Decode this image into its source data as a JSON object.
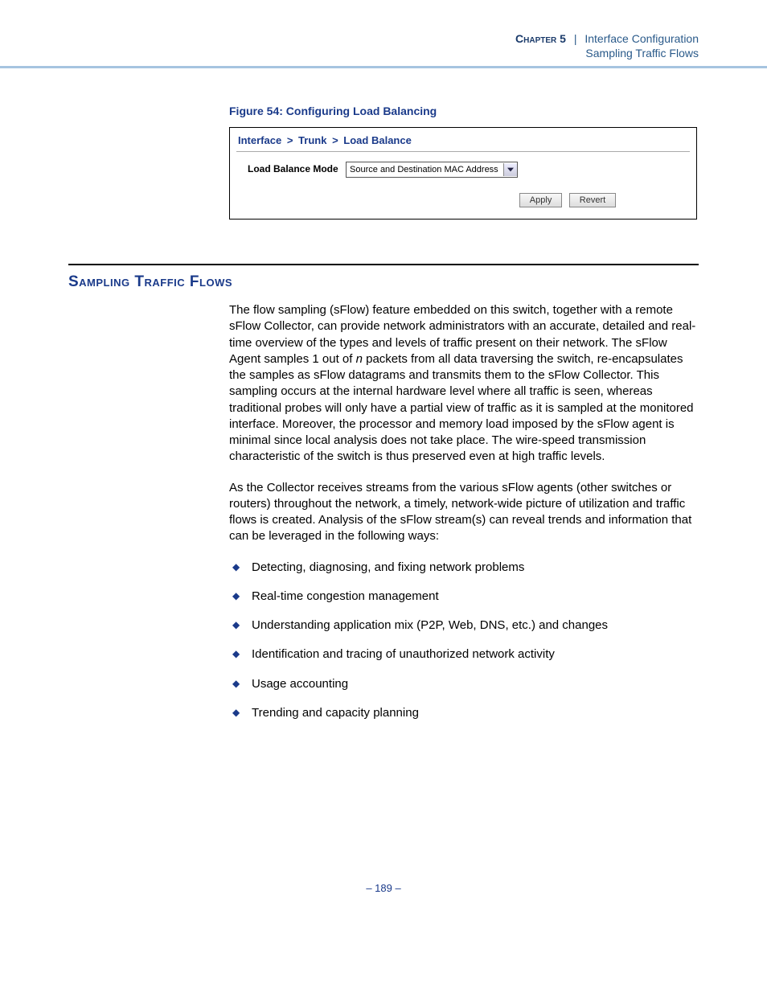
{
  "header": {
    "chapter_label": "Chapter 5",
    "separator": "|",
    "chapter_title": "Interface Configuration",
    "subtitle": "Sampling Traffic Flows"
  },
  "figure": {
    "caption": "Figure 54:  Configuring Load Balancing",
    "breadcrumb": {
      "part1": "Interface",
      "part2": "Trunk",
      "part3": "Load Balance"
    },
    "form": {
      "label": "Load Balance Mode",
      "selected": "Source and Destination MAC Address"
    },
    "buttons": {
      "apply": "Apply",
      "revert": "Revert"
    }
  },
  "section": {
    "heading": "Sampling Traffic Flows",
    "para1_a": "The flow sampling (sFlow) feature embedded on this switch, together with a remote sFlow Collector, can provide network administrators with an accurate, detailed and real-time overview of the types and levels of traffic present on their network. The sFlow Agent samples 1 out of ",
    "para1_em": "n",
    "para1_b": " packets from all data traversing the switch, re-encapsulates the samples as sFlow datagrams and transmits them to the sFlow Collector. This sampling occurs at the internal hardware level where all traffic is seen, whereas traditional probes will only have a partial view of traffic as it is sampled at the monitored interface. Moreover, the processor and memory load imposed by the sFlow agent is minimal since local analysis does not take place. The wire-speed transmission characteristic of the switch is thus preserved even at high traffic levels.",
    "para2": "As the Collector receives streams from the various sFlow agents (other switches or routers) throughout the network, a timely, network-wide picture of utilization and traffic flows is created. Analysis of the sFlow stream(s) can reveal trends and information that can be leveraged in the following ways:",
    "bullets": [
      "Detecting, diagnosing, and fixing network problems",
      "Real-time congestion management",
      "Understanding application mix (P2P, Web, DNS, etc.) and changes",
      "Identification and tracing of unauthorized network activity",
      "Usage accounting",
      "Trending and capacity planning"
    ]
  },
  "page_number": "–  189  –"
}
